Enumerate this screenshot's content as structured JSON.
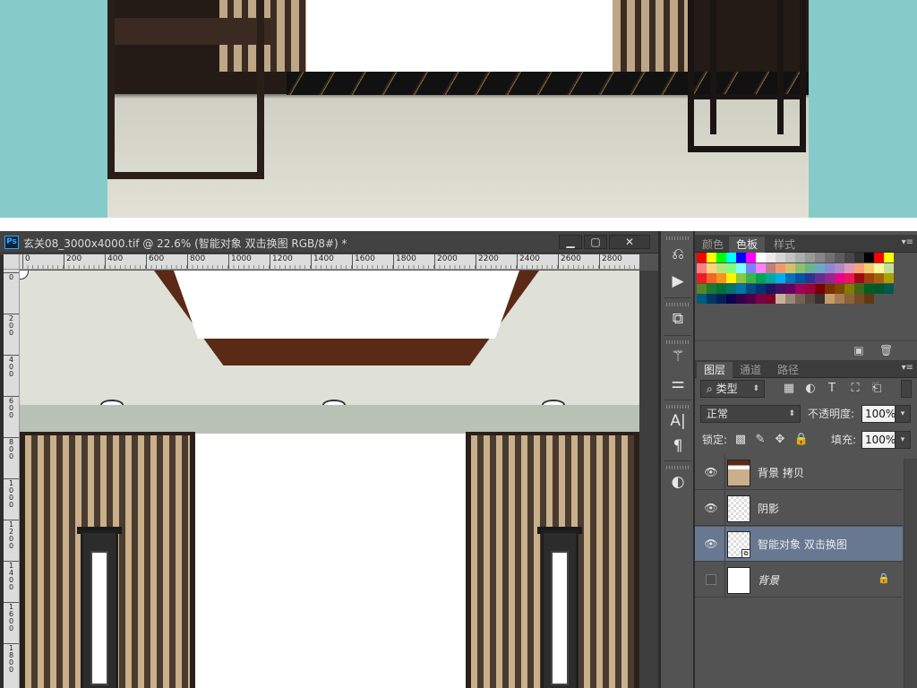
{
  "document": {
    "title": "玄关08_3000x4000.tif @ 22.6% (智能对象 双击换图  RGB/8#) *",
    "app_badge": "Ps",
    "window_buttons": [
      "▁",
      "▢",
      "✕"
    ]
  },
  "ruler": {
    "horizontal": [
      "0",
      "200",
      "400",
      "600",
      "800",
      "1000",
      "1200",
      "1400",
      "1600",
      "1800",
      "2000",
      "2200",
      "2400",
      "2600",
      "2800"
    ],
    "vertical": [
      "0",
      "2\n0\n0",
      "4\n0\n0",
      "6\n0\n0",
      "8\n0\n0",
      "1\n0\n0\n0",
      "1\n2\n0\n0",
      "1\n4\n0\n0",
      "1\n6\n0\n0",
      "1\n8\n0\n0"
    ]
  },
  "tools_icons": [
    "history-icon",
    "play-action-icon",
    "3d-icon",
    "brush-preset-icon",
    "adjust-sliders-icon",
    "character-icon",
    "paragraph-icon",
    "clone-source-icon"
  ],
  "swatch_panel": {
    "tabs": [
      "颜色",
      "色板",
      "样式"
    ],
    "active_tab": "色板",
    "swatch_rows": [
      [
        "#ff0000",
        "#ffff00",
        "#00ff00",
        "#00ffff",
        "#0000ff",
        "#ff00ff",
        "#ffffff",
        "#ebebeb",
        "#d6d6d6",
        "#c2c2c2",
        "#adadad",
        "#999999",
        "#858585",
        "#707070",
        "#5c5c5c",
        "#474747",
        "#333333",
        "#000000",
        "#ff0000",
        "#ffff00"
      ],
      [
        "#ff8080",
        "#ffd280",
        "#b7e37b",
        "#80ff80",
        "#80ffff",
        "#8080ff",
        "#ff80ff",
        "#c08080",
        "#f09a6a",
        "#d4c06a",
        "#8fbf6a",
        "#6ab38f",
        "#6aa9c4",
        "#8a8ad4",
        "#b38ac4",
        "#e09ab8",
        "#f7a277",
        "#fbcc6e",
        "#fff799",
        "#c4df9b"
      ],
      [
        "#ed1c24",
        "#f26522",
        "#f7941d",
        "#fff200",
        "#8dc63f",
        "#39b54a",
        "#00a651",
        "#00a99d",
        "#00aeef",
        "#0072bc",
        "#0054a6",
        "#2e3192",
        "#662d91",
        "#92278f",
        "#ec008c",
        "#ed145b",
        "#9e0b0f",
        "#a0410d",
        "#a36209",
        "#aba000"
      ],
      [
        "#598527",
        "#197b30",
        "#007236",
        "#00746b",
        "#0076a3",
        "#004b80",
        "#003471",
        "#1b1464",
        "#440e62",
        "#630460",
        "#9e005d",
        "#9e0039",
        "#790000",
        "#7b2e00",
        "#7d4900",
        "#827b00",
        "#406618",
        "#005e20",
        "#005826",
        "#005952"
      ],
      [
        "#005b7f",
        "#003663",
        "#002157",
        "#0d004c",
        "#32004b",
        "#4b0049",
        "#7b0046",
        "#7a0026",
        "#c7b299",
        "#998675",
        "#736357",
        "#534741",
        "#37302d",
        "#c69c6d",
        "#a67c52",
        "#8c6239",
        "#754c24",
        "#603913"
      ]
    ]
  },
  "layers_panel": {
    "tabs": [
      "图层",
      "通道",
      "路径"
    ],
    "active_tab": "图层",
    "filter_label": "类型",
    "blend_mode": "正常",
    "opacity_label": "不透明度:",
    "opacity_value": "100%",
    "lock_label": "锁定:",
    "fill_label": "填充:",
    "fill_value": "100%",
    "layers": [
      {
        "name": "背景 拷贝",
        "visible": true,
        "selected": false
      },
      {
        "name": "阴影",
        "visible": true,
        "selected": false
      },
      {
        "name": "智能对象 双击换图",
        "visible": true,
        "selected": true
      },
      {
        "name": "背景",
        "visible": false,
        "selected": false,
        "locked": true
      }
    ]
  },
  "colors": {
    "accent_selection": "#687891",
    "preview_background": "#86cbc9"
  }
}
